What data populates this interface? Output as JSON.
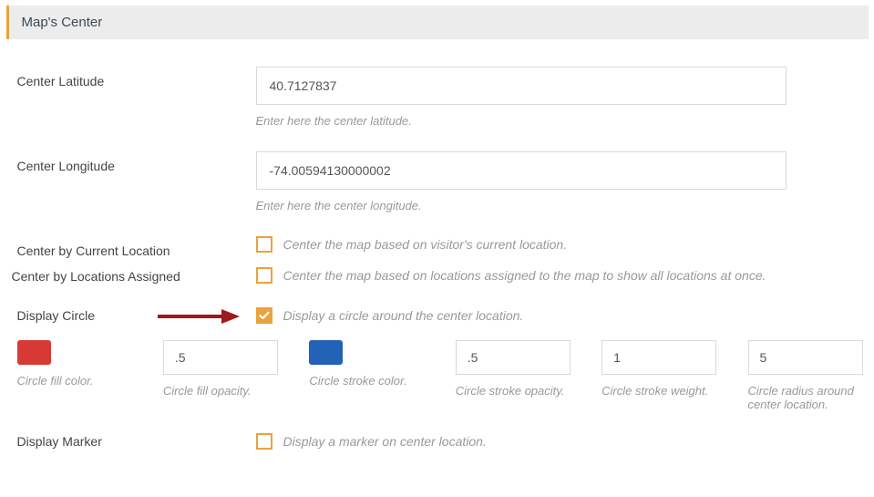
{
  "panel": {
    "title": "Map's Center"
  },
  "fields": {
    "center_lat": {
      "label": "Center Latitude",
      "value": "40.7127837",
      "help": "Enter here the center latitude."
    },
    "center_lng": {
      "label": "Center Longitude",
      "value": "-74.00594130000002",
      "help": "Enter here the center longitude."
    },
    "center_current": {
      "label": "Center by Current Location",
      "desc": "Center the map based on visitor's current location."
    },
    "center_assigned": {
      "label": "Center by Locations Assigned",
      "desc": "Center the map based on locations assigned to the map to show all locations at once."
    },
    "display_circle": {
      "label": "Display Circle",
      "desc": "Display a circle around the center location."
    },
    "display_marker": {
      "label": "Display Marker",
      "desc": "Display a marker on center location."
    }
  },
  "circle": {
    "fill_color": {
      "label": "Circle fill color.",
      "value": "#d73a34"
    },
    "fill_opacity": {
      "label": "Circle fill opacity.",
      "value": ".5"
    },
    "stroke_color": {
      "label": "Circle stroke color.",
      "value": "#2362b6"
    },
    "stroke_opacity": {
      "label": "Circle stroke opacity.",
      "value": ".5"
    },
    "stroke_weight": {
      "label": "Circle stroke weight.",
      "value": "1"
    },
    "radius": {
      "label": "Circle radius around center location.",
      "value": "5"
    }
  }
}
